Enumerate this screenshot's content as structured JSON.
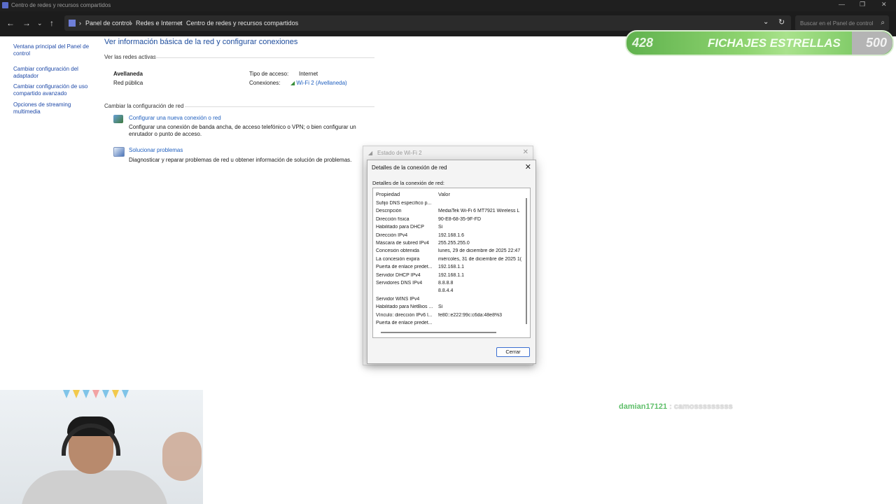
{
  "window": {
    "title": "Centro de redes y recursos compartidos",
    "controls": {
      "minimize": "—",
      "maximize": "❐",
      "close": "✕"
    }
  },
  "address_bar": {
    "crumbs": [
      "Panel de control",
      "Redes e Internet",
      "Centro de redes y recursos compartidos"
    ],
    "separator": "›",
    "search_placeholder": "Buscar en el Panel de control"
  },
  "sidebar": {
    "items": [
      {
        "label": "Ventana principal del Panel de control"
      },
      {
        "label": "Cambiar configuración del adaptador"
      },
      {
        "label": "Cambiar configuración de uso compartido avanzado"
      },
      {
        "label": "Opciones de streaming multimedia"
      }
    ]
  },
  "main": {
    "heading": "Ver información básica de la red y configurar conexiones",
    "active_networks": {
      "section": "Ver las redes activas",
      "name": "Avellaneda",
      "type": "Red pública",
      "access_label": "Tipo de acceso:",
      "access_value": "Internet",
      "connections_label": "Conexiones:",
      "connections_value": "Wi-Fi 2 (Avellaneda)"
    },
    "change_settings": {
      "section": "Cambiar la configuración de red",
      "new_connection": {
        "title": "Configurar una nueva conexión o red",
        "desc1": "Configurar una conexión de banda ancha, de acceso telefónico o VPN; o bien configurar un",
        "desc2": "enrutador o punto de acceso."
      },
      "troubleshoot": {
        "title": "Solucionar problemas",
        "desc": "Diagnosticar y reparar problemas de red u obtener información de solución de problemas."
      }
    }
  },
  "status_dialog": {
    "title": "Estado de Wi-Fi 2"
  },
  "details_dialog": {
    "title": "Detalles de la conexión de red",
    "label": "Detalles de la conexión de red:",
    "col_property": "Propiedad",
    "col_value": "Valor",
    "rows": [
      {
        "p": "Sufijo DNS específico p...",
        "v": ""
      },
      {
        "p": "Descripción",
        "v": "MediaTek Wi-Fi 6 MT7921 Wireless L"
      },
      {
        "p": "Dirección física",
        "v": "90-E8-68-35-9F-FD"
      },
      {
        "p": "Habilitado para DHCP",
        "v": "Sí"
      },
      {
        "p": "Dirección IPv4",
        "v": "192.168.1.6"
      },
      {
        "p": "Máscara de subred IPv4",
        "v": "255.255.255.0"
      },
      {
        "p": "Concesión obtenida",
        "v": "lunes, 29 de diciembre de 2025 22:47"
      },
      {
        "p": "La concesión expira",
        "v": "miércoles, 31 de diciembre de 2025 1("
      },
      {
        "p": "Puerta de enlace predet...",
        "v": "192.168.1.1"
      },
      {
        "p": "Servidor DHCP IPv4",
        "v": "192.168.1.1"
      },
      {
        "p": "Servidores DNS IPv4",
        "v": "8.8.8.8"
      },
      {
        "p": "",
        "v": "8.8.4.4"
      },
      {
        "p": "Servidor WINS IPv4",
        "v": ""
      },
      {
        "p": "Habilitado para NetBios ...",
        "v": "Sí"
      },
      {
        "p": "Vínculo: dirección IPv6 l...",
        "v": "fe80::e222:99c:c6da:48e8%3"
      },
      {
        "p": "Puerta de enlace predet...",
        "v": ""
      }
    ],
    "close_label": "Cerrar"
  },
  "overlay": {
    "badge_left": "428",
    "badge_title": "FICHAJES ESTRELLAS",
    "badge_right": "500",
    "chat_user": "damian17121",
    "chat_sep": ":",
    "chat_message": "camosssssssss"
  }
}
